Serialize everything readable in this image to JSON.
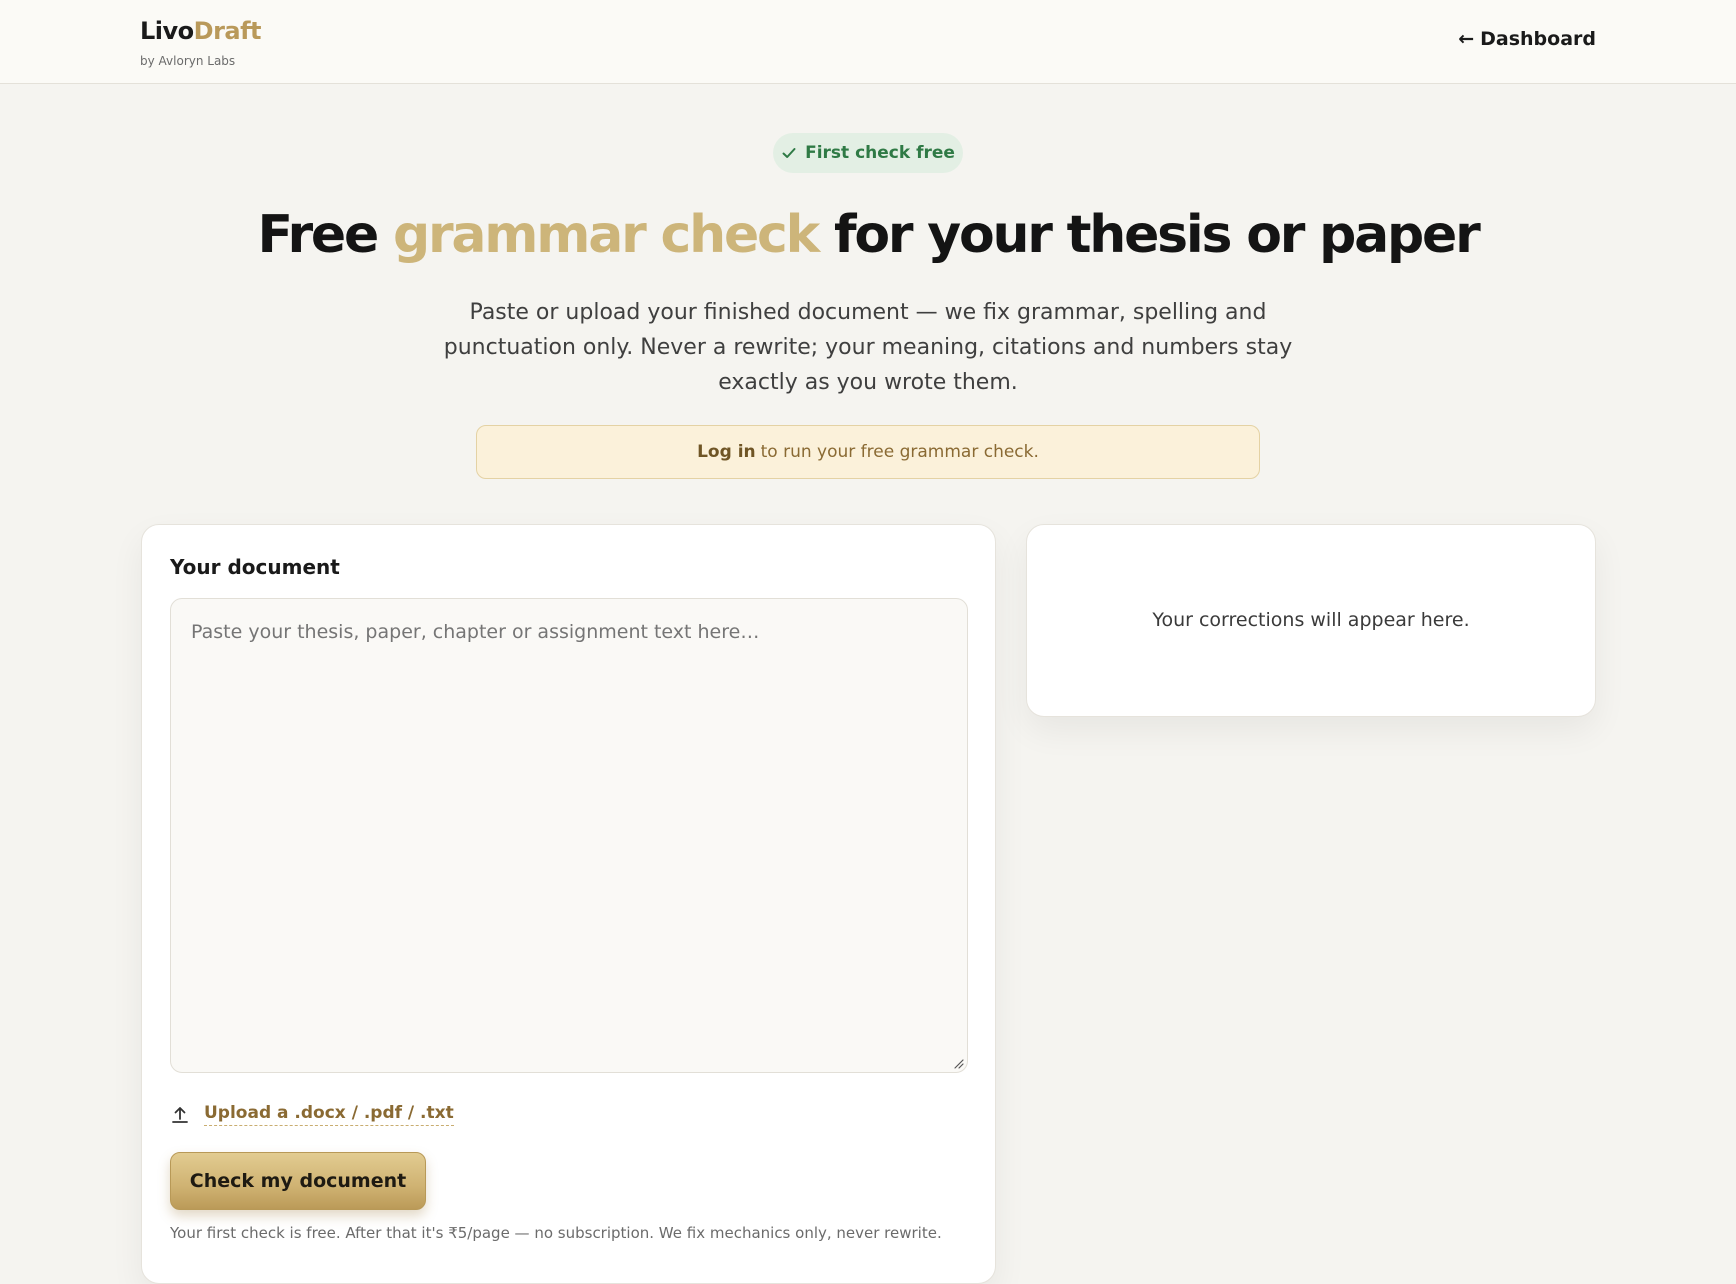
{
  "header": {
    "brand_part1": "Livo",
    "brand_part2": "Draft",
    "brand_sub": "by Avloryn Labs",
    "back_arrow": "←",
    "back_label": "Dashboard"
  },
  "hero": {
    "badge": "First check free",
    "title_part1": "Free ",
    "title_accent": "grammar check",
    "title_part2": " for your thesis or paper",
    "subtitle": "Paste or upload your finished document — we fix grammar, spelling and punctuation only. Never a rewrite; your meaning, citations and numbers stay exactly as you wrote them.",
    "login_link": "Log in",
    "login_text": "to run your free grammar check."
  },
  "document": {
    "title": "Your document",
    "placeholder": "Paste your thesis, paper, chapter or assignment text here…",
    "upload_label": "Upload a .docx / .pdf / .txt",
    "submit_label": "Check my document",
    "fine_print": "Your first check is free. After that it's ₹5/page — no subscription. We fix mechanics only, never rewrite."
  },
  "results": {
    "empty_text": "Your corrections will appear here."
  },
  "colors": {
    "accent_gold": "#cdb57a",
    "badge_green": "#2f7a45",
    "page_bg": "#f5f4f0"
  },
  "icons": {
    "badge": "check-icon",
    "upload": "upload-icon",
    "back": "arrow-left-icon"
  }
}
